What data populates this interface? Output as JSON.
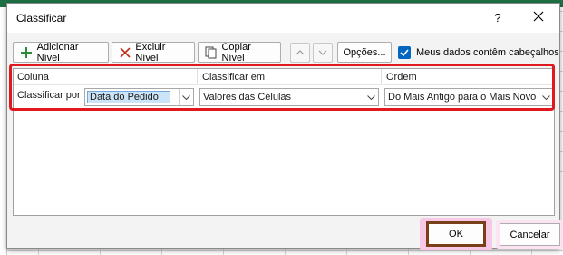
{
  "window": {
    "title": "Classificar",
    "help_glyph": "?",
    "close_glyph": "✕"
  },
  "toolbar": {
    "add_level": {
      "label": "Adicionar Nível",
      "icon": "plus-icon"
    },
    "delete_level": {
      "label": "Excluir Nível",
      "icon": "x-icon"
    },
    "copy_level": {
      "label": "Copiar Nível",
      "icon": "copy-icon"
    },
    "move_up": {
      "icon": "chevron-up-icon"
    },
    "move_down": {
      "icon": "chevron-down-icon"
    },
    "options": {
      "label": "Opções..."
    },
    "headers_checkbox": {
      "label": "Meus dados contêm cabeçalhos",
      "checked": true
    }
  },
  "columns": {
    "column": "Coluna",
    "sort_on": "Classificar em",
    "order": "Ordem"
  },
  "levels": [
    {
      "row_label": "Classificar por",
      "column": "Data do Pedido",
      "sort_on": "Valores das Células",
      "order": "Do Mais Antigo para o Mais Novo"
    }
  ],
  "footer": {
    "ok": "OK",
    "cancel": "Cancelar"
  },
  "colors": {
    "accent": "#0067c0",
    "highlight": "#e0191f",
    "ok_border": "#7a3f18",
    "excel_green": "#1e7145"
  }
}
